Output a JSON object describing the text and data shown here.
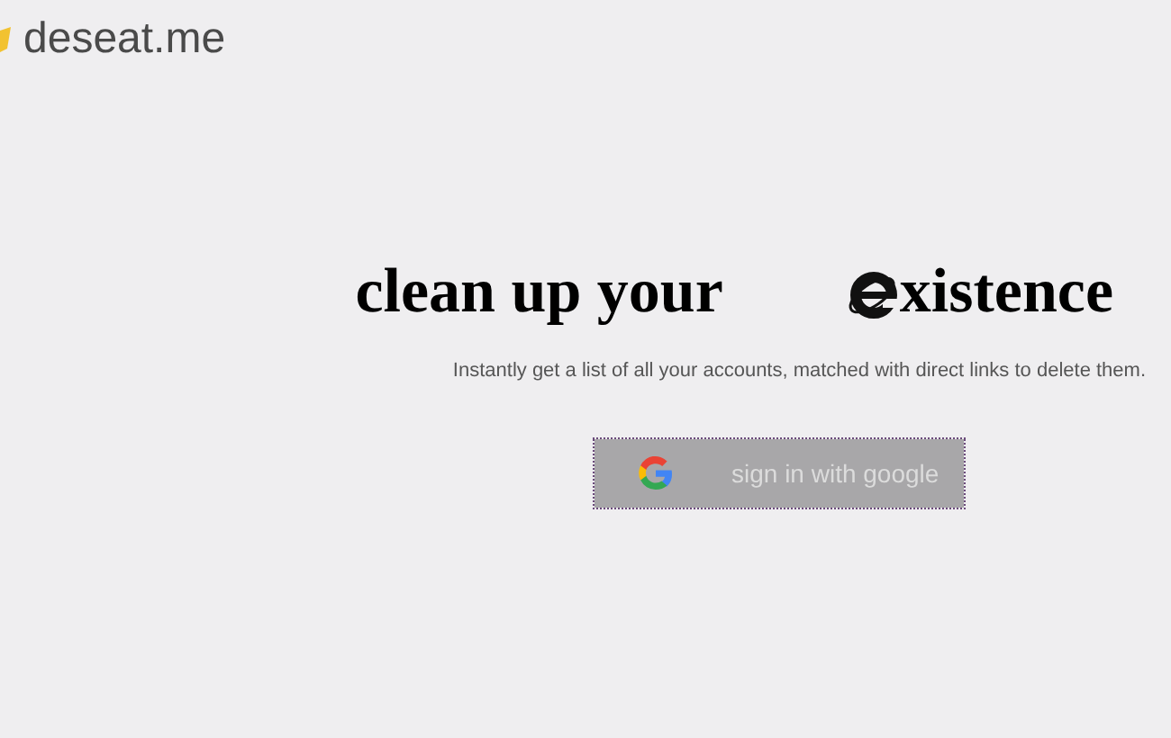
{
  "logo": {
    "text": "deseat.me"
  },
  "headline": {
    "before": "clean up your",
    "after": "xistence"
  },
  "subtitle": "Instantly get a list of all your accounts, matched with direct links to delete them.",
  "signin_button": {
    "label": "sign in with google",
    "focused": true
  }
}
